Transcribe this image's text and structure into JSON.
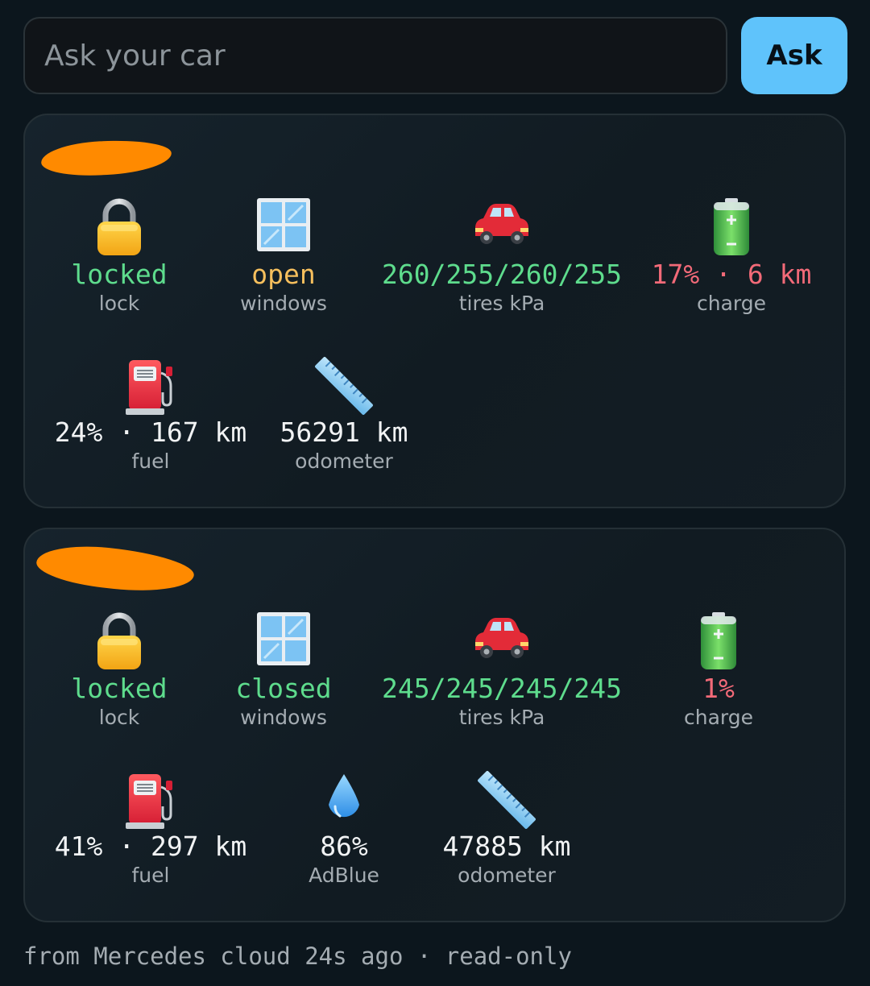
{
  "search": {
    "placeholder": "Ask your car",
    "button_label": "Ask"
  },
  "colors": {
    "ok": "#5edc8d",
    "warn": "#f6bf5d",
    "bad": "#f26a78",
    "neutral": "#f1f3f4",
    "accent": "#5fc3fb"
  },
  "vehicles": [
    {
      "lock": {
        "value": "locked",
        "label": "lock",
        "icon": "padlock-icon"
      },
      "windows": {
        "value": "open",
        "label": "windows",
        "icon": "window-icon"
      },
      "tires": {
        "value": "260/255/260/255",
        "label": "tires kPa",
        "icon": "car-icon"
      },
      "charge": {
        "value": "17% · 6 km",
        "label": "charge",
        "icon": "battery-icon"
      },
      "fuel": {
        "value": "24% · 167 km",
        "label": "fuel",
        "icon": "fuel-pump-icon"
      },
      "odometer": {
        "value": "56291 km",
        "label": "odometer",
        "icon": "ruler-icon"
      }
    },
    {
      "lock": {
        "value": "locked",
        "label": "lock",
        "icon": "padlock-icon"
      },
      "windows": {
        "value": "closed",
        "label": "windows",
        "icon": "window-icon"
      },
      "tires": {
        "value": "245/245/245/245",
        "label": "tires kPa",
        "icon": "car-icon"
      },
      "charge": {
        "value": "1%",
        "label": "charge",
        "icon": "battery-icon"
      },
      "fuel": {
        "value": "41% · 297 km",
        "label": "fuel",
        "icon": "fuel-pump-icon"
      },
      "adblue": {
        "value": "86%",
        "label": "AdBlue",
        "icon": "droplet-icon"
      },
      "odometer": {
        "value": "47885 km",
        "label": "odometer",
        "icon": "ruler-icon"
      }
    }
  ],
  "footer": {
    "text": "from Mercedes cloud 24s ago · read-only"
  }
}
